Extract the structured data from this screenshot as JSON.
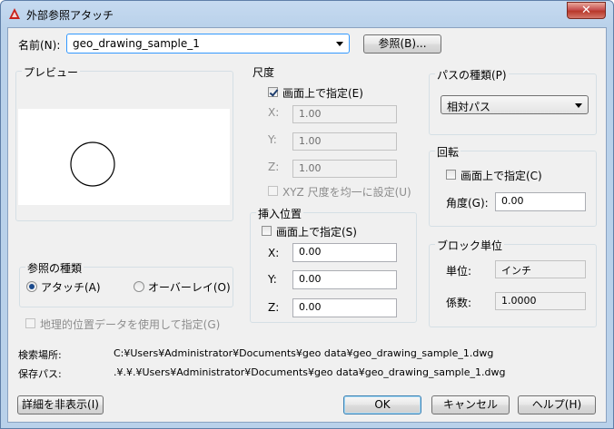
{
  "window": {
    "title": "外部参照アタッチ",
    "close_label": "✕"
  },
  "name_row": {
    "label": "名前(N):",
    "value": "geo_drawing_sample_1",
    "browse_label": "参照(B)..."
  },
  "preview": {
    "title": "プレビュー"
  },
  "ref_type": {
    "title": "参照の種類",
    "options": [
      {
        "label": "アタッチ(A)",
        "checked": true
      },
      {
        "label": "オーバーレイ(O)",
        "checked": false
      }
    ]
  },
  "geo_checkbox": {
    "label": "地理的位置データを使用して指定(G)"
  },
  "scale": {
    "title": "尺度",
    "onscreen_label": "画面上で指定(E)",
    "x_label": "X:",
    "x_value": "1.00",
    "y_label": "Y:",
    "y_value": "1.00",
    "z_label": "Z:",
    "z_value": "1.00",
    "uniform_label": "XYZ 尺度を均一に設定(U)"
  },
  "insertion": {
    "title": "挿入位置",
    "onscreen_label": "画面上で指定(S)",
    "x_label": "X:",
    "x_value": "0.00",
    "y_label": "Y:",
    "y_value": "0.00",
    "z_label": "Z:",
    "z_value": "0.00"
  },
  "path_type": {
    "title": "パスの種類(P)",
    "value": "相対パス"
  },
  "rotation": {
    "title": "回転",
    "onscreen_label": "画面上で指定(C)",
    "angle_label": "角度(G):",
    "angle_value": "0.00"
  },
  "block_unit": {
    "title": "ブロック単位",
    "unit_label": "単位:",
    "unit_value": "インチ",
    "factor_label": "係数:",
    "factor_value": "1.0000"
  },
  "found_in": {
    "label": "検索場所:",
    "value": "C:¥Users¥Administrator¥Documents¥geo data¥geo_drawing_sample_1.dwg"
  },
  "saved_path": {
    "label": "保存パス:",
    "value": ".¥.¥.¥Users¥Administrator¥Documents¥geo data¥geo_drawing_sample_1.dwg"
  },
  "buttons": {
    "hide_details": "詳細を非表示(I)",
    "ok": "OK",
    "cancel": "キャンセル",
    "help": "ヘルプ(H)"
  },
  "colors": {
    "accent": "#3399ff",
    "title_bar": "#b9d1ea",
    "client_bg": "#f0f0f0"
  },
  "icons": {
    "app": "autocad-logo-icon",
    "close": "close-icon",
    "dropdown": "chevron-down-icon"
  }
}
